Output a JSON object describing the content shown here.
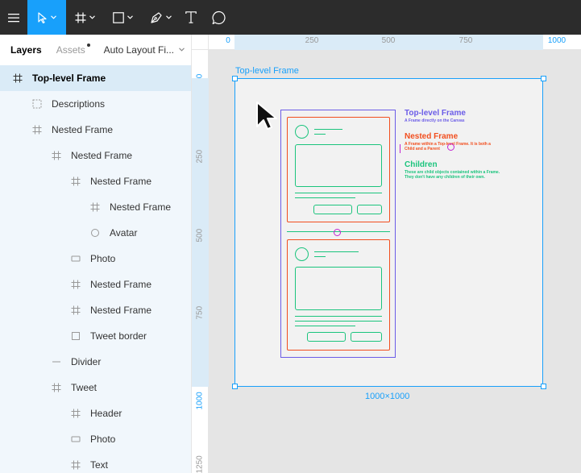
{
  "toolbar": {
    "icons": [
      "menu-icon",
      "move-tool-icon",
      "frame-tool-icon",
      "shape-tool-icon",
      "pen-tool-icon",
      "text-tool-icon",
      "comment-icon"
    ],
    "accent": "#18a0fb",
    "background": "#2c2c2c"
  },
  "sidebar": {
    "tab_layers": "Layers",
    "tab_assets": "Assets",
    "page_select": "Auto Layout Fi...",
    "layers": [
      {
        "label": "Top-level Frame",
        "icon": "frame-icon",
        "depth": 0,
        "selected": true
      },
      {
        "label": "Descriptions",
        "icon": "group-icon",
        "depth": 1
      },
      {
        "label": "Nested Frame",
        "icon": "frame-icon",
        "depth": 1
      },
      {
        "label": "Nested Frame",
        "icon": "frame-icon",
        "depth": 2
      },
      {
        "label": "Nested Frame",
        "icon": "frame-icon",
        "depth": 3
      },
      {
        "label": "Nested Frame",
        "icon": "frame-icon",
        "depth": 4
      },
      {
        "label": "Avatar",
        "icon": "ellipse-icon",
        "depth": 4
      },
      {
        "label": "Photo",
        "icon": "rectangle-icon",
        "depth": 3
      },
      {
        "label": "Nested Frame",
        "icon": "frame-icon",
        "depth": 3
      },
      {
        "label": "Nested Frame",
        "icon": "frame-icon",
        "depth": 3
      },
      {
        "label": "Tweet border",
        "icon": "square-icon",
        "depth": 3
      },
      {
        "label": "Divider",
        "icon": "line-icon",
        "depth": 2
      },
      {
        "label": "Tweet",
        "icon": "frame-icon",
        "depth": 2
      },
      {
        "label": "Header",
        "icon": "frame-icon",
        "depth": 3
      },
      {
        "label": "Photo",
        "icon": "rectangle-icon",
        "depth": 3
      },
      {
        "label": "Text",
        "icon": "frame-icon",
        "depth": 3
      }
    ]
  },
  "ruler_top": [
    "0",
    "250",
    "500",
    "750",
    "1000"
  ],
  "ruler_left": [
    "0",
    "250",
    "500",
    "750",
    "1000",
    "1250"
  ],
  "canvas": {
    "frame_label": "Top-level Frame",
    "size_label": "1000×1000",
    "descriptions": [
      {
        "title": "Top-level Frame",
        "subtitle": "A Frame directly on the Canvas",
        "color": "#6b5ce7"
      },
      {
        "title": "Nested Frame",
        "subtitle": "A Frame within a Top-level Frame. It is both a Child and a Parent",
        "color": "#f24e1e"
      },
      {
        "title": "Children",
        "subtitle": "These are child objects contained within a Frame. They don't have any children of their own.",
        "color": "#1bc47d"
      }
    ]
  }
}
